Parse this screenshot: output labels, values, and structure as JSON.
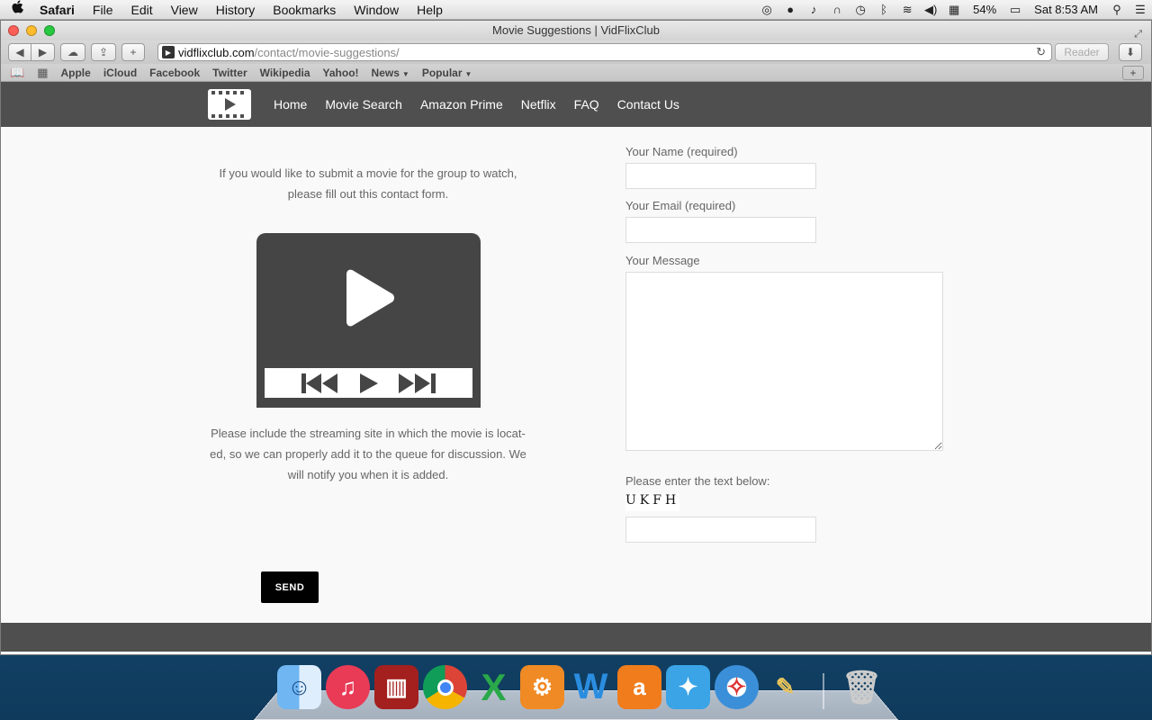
{
  "menubar": {
    "apple": "",
    "items": [
      "Safari",
      "File",
      "Edit",
      "View",
      "History",
      "Bookmarks",
      "Window",
      "Help"
    ],
    "battery": "54%",
    "clock": "Sat 8:53 AM"
  },
  "window": {
    "title": "Movie Suggestions | VidFlixClub",
    "url_host": "vidflixclub.com",
    "url_path": "/contact/movie-suggestions/",
    "reader_label": "Reader"
  },
  "bookmarks": [
    "Apple",
    "iCloud",
    "Facebook",
    "Twitter",
    "Wikipedia",
    "Yahoo!",
    "News",
    "Popular"
  ],
  "site": {
    "nav": [
      "Home",
      "Movie Search",
      "Amazon Prime",
      "Netflix",
      "FAQ",
      "Contact Us"
    ],
    "intro_line1": "If you would like to submit a movie for the group to watch,",
    "intro_line2": "please fill out this contact form.",
    "note_line1": "Please include the streaming site in which the movie is locat-",
    "note_line2": "ed, so we can properly add it to the queue for discussion. We",
    "note_line3": "will notify you when it is added."
  },
  "form": {
    "name_label": "Your Name (required)",
    "email_label": "Your Email (required)",
    "message_label": "Your Message",
    "captcha_label": "Please enter the text below:",
    "captcha_text": "UKFH",
    "send_label": "SEND"
  },
  "dock": [
    "Finder",
    "iTunes",
    "Photo Booth",
    "Chrome",
    "Excel",
    "System Preferences",
    "Word",
    "Amazon",
    "Twitter",
    "Safari",
    "Paintbrush",
    "Trash"
  ],
  "colors": {
    "nav_bg": "#4f4f4f",
    "send_bg": "#000000",
    "player_bg": "#454545"
  }
}
